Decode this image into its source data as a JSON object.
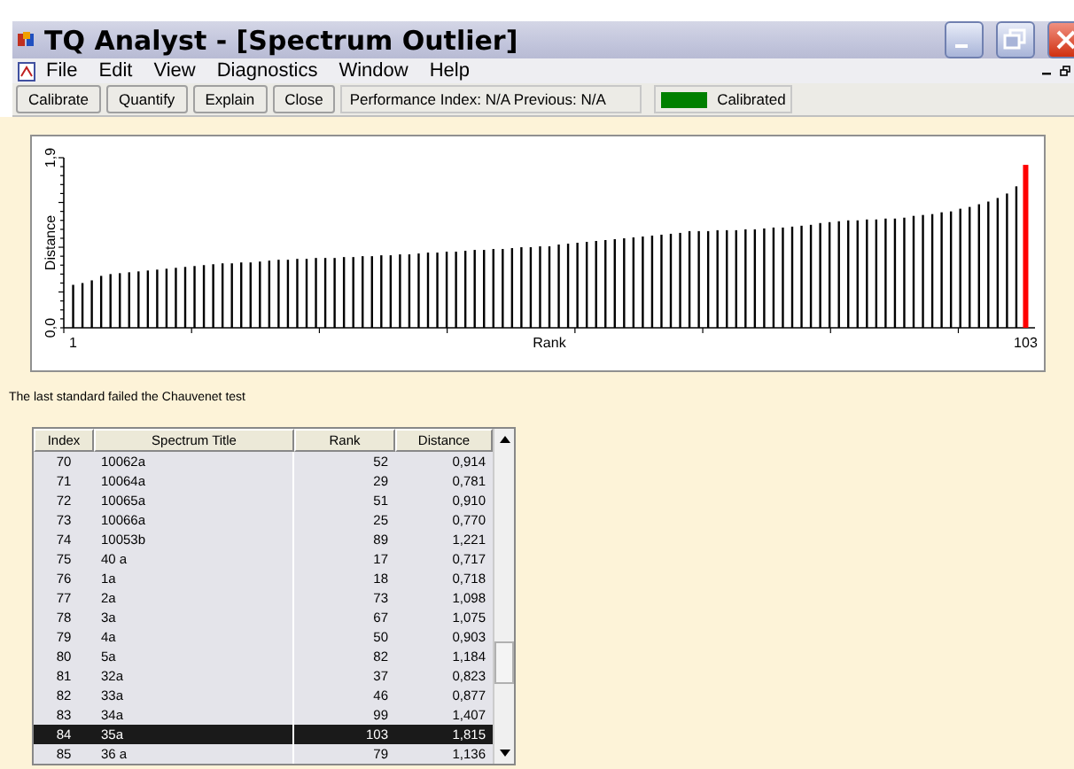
{
  "window": {
    "title": "TQ Analyst  - [Spectrum Outlier]"
  },
  "menu": [
    "File",
    "Edit",
    "View",
    "Diagnostics",
    "Window",
    "Help"
  ],
  "toolbar": {
    "buttons": [
      "Calibrate",
      "Quantify",
      "Explain",
      "Close"
    ],
    "performance": "Performance Index:  N/A  Previous:  N/A",
    "status": {
      "label": "Calibrated",
      "color": "#008000"
    }
  },
  "chart": {
    "chart_data": {
      "type": "bar",
      "xlabel": "Rank",
      "ylabel": "Distance",
      "ylim": [
        0,
        1.9
      ],
      "xlim": [
        0,
        104
      ],
      "xticks": [
        {
          "value": 1,
          "label": "1"
        },
        {
          "value": 103,
          "label": "103"
        }
      ],
      "yticks": [
        {
          "value": 0,
          "label": "0,0"
        },
        {
          "value": 1.9,
          "label": "1,9"
        }
      ],
      "x": [
        1,
        2,
        3,
        4,
        5,
        6,
        7,
        8,
        9,
        10,
        11,
        12,
        13,
        14,
        15,
        16,
        17,
        18,
        19,
        20,
        21,
        22,
        23,
        24,
        25,
        26,
        27,
        28,
        29,
        30,
        31,
        32,
        33,
        34,
        35,
        36,
        37,
        38,
        39,
        40,
        41,
        42,
        43,
        44,
        45,
        46,
        47,
        48,
        49,
        50,
        51,
        52,
        53,
        54,
        55,
        56,
        57,
        58,
        59,
        60,
        61,
        62,
        63,
        64,
        65,
        66,
        67,
        68,
        69,
        70,
        71,
        72,
        73,
        74,
        75,
        76,
        77,
        78,
        79,
        80,
        81,
        82,
        83,
        84,
        85,
        86,
        87,
        88,
        89,
        90,
        91,
        92,
        93,
        94,
        95,
        96,
        97,
        98,
        99,
        100,
        101,
        102,
        103
      ],
      "series": [
        {
          "color": "#000000",
          "values": [
            0.48,
            0.5,
            0.53,
            0.58,
            0.6,
            0.61,
            0.62,
            0.63,
            0.64,
            0.65,
            0.66,
            0.67,
            0.68,
            0.69,
            0.7,
            0.71,
            0.72,
            0.72,
            0.73,
            0.73,
            0.74,
            0.75,
            0.76,
            0.76,
            0.77,
            0.77,
            0.78,
            0.78,
            0.78,
            0.79,
            0.79,
            0.8,
            0.8,
            0.81,
            0.81,
            0.82,
            0.82,
            0.83,
            0.84,
            0.84,
            0.85,
            0.85,
            0.86,
            0.87,
            0.87,
            0.88,
            0.88,
            0.89,
            0.9,
            0.9,
            0.91,
            0.91,
            0.93,
            0.94,
            0.95,
            0.96,
            0.97,
            0.98,
            0.99,
            1.0,
            1.01,
            1.02,
            1.03,
            1.04,
            1.05,
            1.06,
            1.08,
            1.08,
            1.08,
            1.09,
            1.09,
            1.09,
            1.1,
            1.1,
            1.11,
            1.12,
            1.12,
            1.13,
            1.14,
            1.15,
            1.17,
            1.18,
            1.19,
            1.2,
            1.2,
            1.21,
            1.21,
            1.22,
            1.22,
            1.23,
            1.25,
            1.26,
            1.27,
            1.29,
            1.3,
            1.33,
            1.35,
            1.38,
            1.41,
            1.45,
            1.5,
            1.58,
            null
          ]
        },
        {
          "color": "#ff0000",
          "values": [
            null,
            null,
            null,
            null,
            null,
            null,
            null,
            null,
            null,
            null,
            null,
            null,
            null,
            null,
            null,
            null,
            null,
            null,
            null,
            null,
            null,
            null,
            null,
            null,
            null,
            null,
            null,
            null,
            null,
            null,
            null,
            null,
            null,
            null,
            null,
            null,
            null,
            null,
            null,
            null,
            null,
            null,
            null,
            null,
            null,
            null,
            null,
            null,
            null,
            null,
            null,
            null,
            null,
            null,
            null,
            null,
            null,
            null,
            null,
            null,
            null,
            null,
            null,
            null,
            null,
            null,
            null,
            null,
            null,
            null,
            null,
            null,
            null,
            null,
            null,
            null,
            null,
            null,
            null,
            null,
            null,
            null,
            null,
            null,
            null,
            null,
            null,
            null,
            null,
            null,
            null,
            null,
            null,
            null,
            null,
            null,
            null,
            null,
            null,
            null,
            null,
            null,
            1.82
          ]
        }
      ]
    }
  },
  "message": "The last standard failed the Chauvenet test",
  "table": {
    "columns": [
      "Index",
      "Spectrum Title",
      "Rank",
      "Distance"
    ],
    "rows": [
      {
        "cells": [
          "70",
          "10062a",
          "52",
          "0,914"
        ],
        "selected": false
      },
      {
        "cells": [
          "71",
          "10064a",
          "29",
          "0,781"
        ],
        "selected": false
      },
      {
        "cells": [
          "72",
          "10065a",
          "51",
          "0,910"
        ],
        "selected": false
      },
      {
        "cells": [
          "73",
          "10066a",
          "25",
          "0,770"
        ],
        "selected": false
      },
      {
        "cells": [
          "74",
          "10053b",
          "89",
          "1,221"
        ],
        "selected": false
      },
      {
        "cells": [
          "75",
          "40 a",
          "17",
          "0,717"
        ],
        "selected": false
      },
      {
        "cells": [
          "76",
          "1a",
          "18",
          "0,718"
        ],
        "selected": false
      },
      {
        "cells": [
          "77",
          "2a",
          "73",
          "1,098"
        ],
        "selected": false
      },
      {
        "cells": [
          "78",
          "3a",
          "67",
          "1,075"
        ],
        "selected": false
      },
      {
        "cells": [
          "79",
          "4a",
          "50",
          "0,903"
        ],
        "selected": false
      },
      {
        "cells": [
          "80",
          "5a",
          "82",
          "1,184"
        ],
        "selected": false
      },
      {
        "cells": [
          "81",
          "32a",
          "37",
          "0,823"
        ],
        "selected": false
      },
      {
        "cells": [
          "82",
          "33a",
          "46",
          "0,877"
        ],
        "selected": false
      },
      {
        "cells": [
          "83",
          "34a",
          "99",
          "1,407"
        ],
        "selected": false
      },
      {
        "cells": [
          "84",
          "35a",
          "103",
          "1,815"
        ],
        "selected": true
      },
      {
        "cells": [
          "85",
          "36 a",
          "79",
          "1,136"
        ],
        "selected": false
      }
    ]
  }
}
